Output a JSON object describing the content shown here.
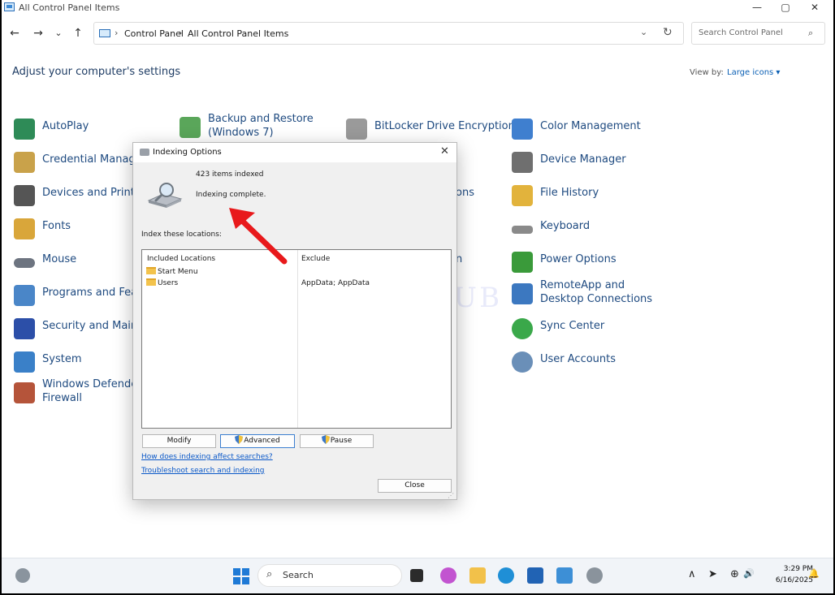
{
  "window": {
    "title": "All Control Panel Items",
    "minimize": "—",
    "maximize": "▢",
    "close": "✕"
  },
  "nav": {
    "back": "←",
    "forward": "→",
    "recent": "⌄",
    "up": "↑",
    "breadcrumb": [
      "Control Panel",
      "All Control Panel Items"
    ],
    "sep": "›",
    "dropdown": "⌄",
    "refresh": "↻",
    "search_placeholder": "Search Control Panel",
    "search_icon": "⌕"
  },
  "heading": "Adjust your computer's settings",
  "view_by": {
    "label": "View by:",
    "value": "Large icons ▾"
  },
  "items": [
    {
      "label": "AutoPlay",
      "icon": "autoplay-icon",
      "color": "#2e8b57"
    },
    {
      "label": "Backup and Restore (Windows 7)",
      "icon": "backup-icon",
      "color": "#5aa65a"
    },
    {
      "label": "BitLocker Drive Encryption",
      "icon": "bitlocker-icon",
      "color": "#9a9a9a"
    },
    {
      "label": "Color Management",
      "icon": "color-management-icon",
      "color": "#3f7fcf"
    },
    {
      "label": "Credential Manager",
      "icon": "credential-icon",
      "color": "#c9a24a"
    },
    {
      "label": "Device Manager",
      "icon": "device-manager-icon",
      "color": "#6f6f6f"
    },
    {
      "label": "Devices and Printers",
      "icon": "printer-icon",
      "color": "#555555"
    },
    {
      "label": "ons",
      "icon": "partial-icon",
      "color": "#ffffff"
    },
    {
      "label": "File History",
      "icon": "file-history-icon",
      "color": "#e2b33c"
    },
    {
      "label": "Fonts",
      "icon": "fonts-icon",
      "color": "#d9a63a"
    },
    {
      "label": "Keyboard",
      "icon": "keyboard-icon",
      "color": "#8a8a8a"
    },
    {
      "label": "Mouse",
      "icon": "mouse-icon",
      "color": "#6d7480"
    },
    {
      "label": "n",
      "icon": "partial-icon",
      "color": "#ffffff"
    },
    {
      "label": "Power Options",
      "icon": "power-icon",
      "color": "#3a9a3a"
    },
    {
      "label": "Programs and Features",
      "icon": "programs-icon",
      "color": "#4a86c8"
    },
    {
      "label": "RemoteApp and Desktop Connections",
      "icon": "remoteapp-icon",
      "color": "#3c78c0"
    },
    {
      "label": "Security and Maintenance",
      "icon": "security-flag-icon",
      "color": "#2c4fa8"
    },
    {
      "label": "Sync Center",
      "icon": "sync-icon",
      "color": "#3aa84a"
    },
    {
      "label": "System",
      "icon": "system-icon",
      "color": "#3a80c8"
    },
    {
      "label": "User Accounts",
      "icon": "user-accounts-icon",
      "color": "#6a8fb8"
    },
    {
      "label": "Windows Defender Firewall",
      "icon": "firewall-icon",
      "color": "#b5543a"
    }
  ],
  "watermark": "IT Pros HUB",
  "dialog": {
    "title": "Indexing Options",
    "close": "✕",
    "items_indexed": "423 items indexed",
    "status": "Indexing complete.",
    "locations_label": "Index these locations:",
    "included_header": "Included Locations",
    "exclude_header": "Exclude",
    "locations": [
      "Start Menu",
      "Users"
    ],
    "exclude_value": "AppData; AppData",
    "modify": "Modify",
    "advanced": "Advanced",
    "pause": "Pause",
    "link_1": "How does indexing affect searches?",
    "link_2": "Troubleshoot search and indexing",
    "close_button": "Close"
  },
  "taskbar": {
    "search_text": "Search",
    "search_icon": "⌕",
    "tray_chevron": "∧",
    "tray_location": "➤",
    "tray_network": "⊕",
    "tray_volume": "🔊",
    "tray_bell": "🔔",
    "time": "3:29 PM",
    "date": "6/16/2025",
    "apps": [
      {
        "name": "task-view-icon",
        "color": "#2b2b2b"
      },
      {
        "name": "copilot-icon",
        "color": "#c254d0"
      },
      {
        "name": "file-explorer-icon",
        "color": "#f2c14a"
      },
      {
        "name": "edge-icon",
        "color": "#1f8fd6"
      },
      {
        "name": "store-icon",
        "color": "#2163b4"
      },
      {
        "name": "control-panel-icon",
        "color": "#3d8fd6"
      },
      {
        "name": "indexing-options-icon",
        "color": "#8a939c"
      }
    ]
  }
}
